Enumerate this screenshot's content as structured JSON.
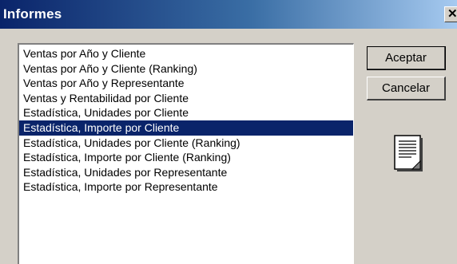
{
  "window": {
    "title": "Informes",
    "close_glyph": "✕"
  },
  "reports": {
    "selected_index": 5,
    "items": [
      "Ventas por Año y Cliente",
      "Ventas por Año y Cliente (Ranking)",
      "Ventas por Año y Representante",
      "Ventas y Rentabilidad por Cliente",
      "Estadística, Unidades por Cliente",
      "Estadística, Importe por Cliente",
      "Estadística, Unidades por Cliente (Ranking)",
      "Estadística, Importe por Cliente (Ranking)",
      "Estadística, Unidades por Representante",
      "Estadística, Importe por Representante"
    ]
  },
  "buttons": {
    "ok_label": "Aceptar",
    "cancel_label": "Cancelar"
  },
  "icons": {
    "report": "report-document-icon"
  },
  "colors": {
    "titlebar_start": "#0a246a",
    "titlebar_end": "#a6caf0",
    "selection": "#0a246a",
    "face": "#d4d0c8"
  }
}
